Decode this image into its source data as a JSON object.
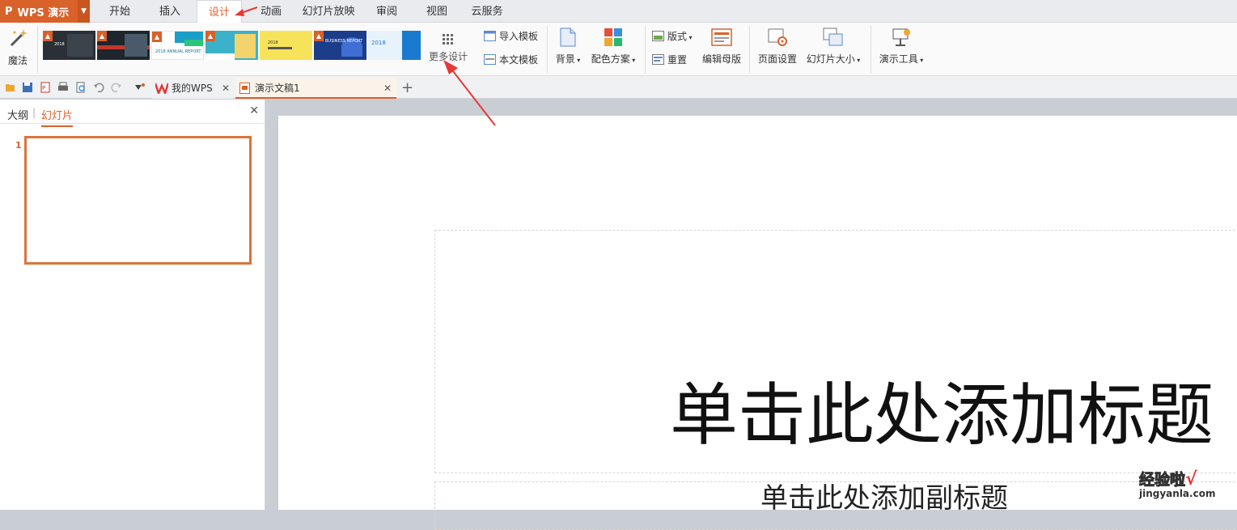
{
  "app": {
    "name": "WPS 演示"
  },
  "menu": {
    "tabs": [
      {
        "label": "开始"
      },
      {
        "label": "插入"
      },
      {
        "label": "设计"
      },
      {
        "label": "动画"
      },
      {
        "label": "幻灯片放映"
      },
      {
        "label": "审阅"
      },
      {
        "label": "视图"
      },
      {
        "label": "云服务"
      }
    ],
    "active_tab": "设计"
  },
  "ribbon": {
    "magic": "魔法",
    "templates": [
      {
        "text": "2018",
        "bg": "#2a3036"
      },
      {
        "text": "",
        "bg": "#1f252c"
      },
      {
        "text": "2018 ANNUAL REPORT",
        "bg": "#ffffff"
      },
      {
        "text": "",
        "bg": "#3bb2c9"
      },
      {
        "text": "2018",
        "bg": "#f7e35a"
      },
      {
        "text": "BUSINESS REPORT",
        "bg": "#1c3d8a"
      },
      {
        "text": "2018",
        "bg": "#e8f2fb"
      }
    ],
    "more_design": "更多设计",
    "import_template": "导入模板",
    "this_template": "本文模板",
    "background": "背景",
    "color_scheme": "配色方案",
    "layout": "版式",
    "reset": "重置",
    "edit_master": "编辑母版",
    "page_setup": "页面设置",
    "slide_size": "幻灯片大小",
    "presentation_tools": "演示工具"
  },
  "quickbar": {
    "tabs": [
      {
        "label": "我的WPS"
      },
      {
        "label": "演示文稿1"
      }
    ],
    "add": "+"
  },
  "left_pane": {
    "tab_outline": "大纲",
    "tab_slides": "幻灯片",
    "divider": "|",
    "slide_number": "1"
  },
  "slide": {
    "title_placeholder": "单击此处添加标题",
    "subtitle_placeholder": "单击此处添加副标题"
  },
  "watermark": {
    "text": "经验啦",
    "url": "jingyanla.com",
    "check": "√"
  },
  "colors": {
    "accent": "#d9612a",
    "arrow": "#e53935"
  }
}
